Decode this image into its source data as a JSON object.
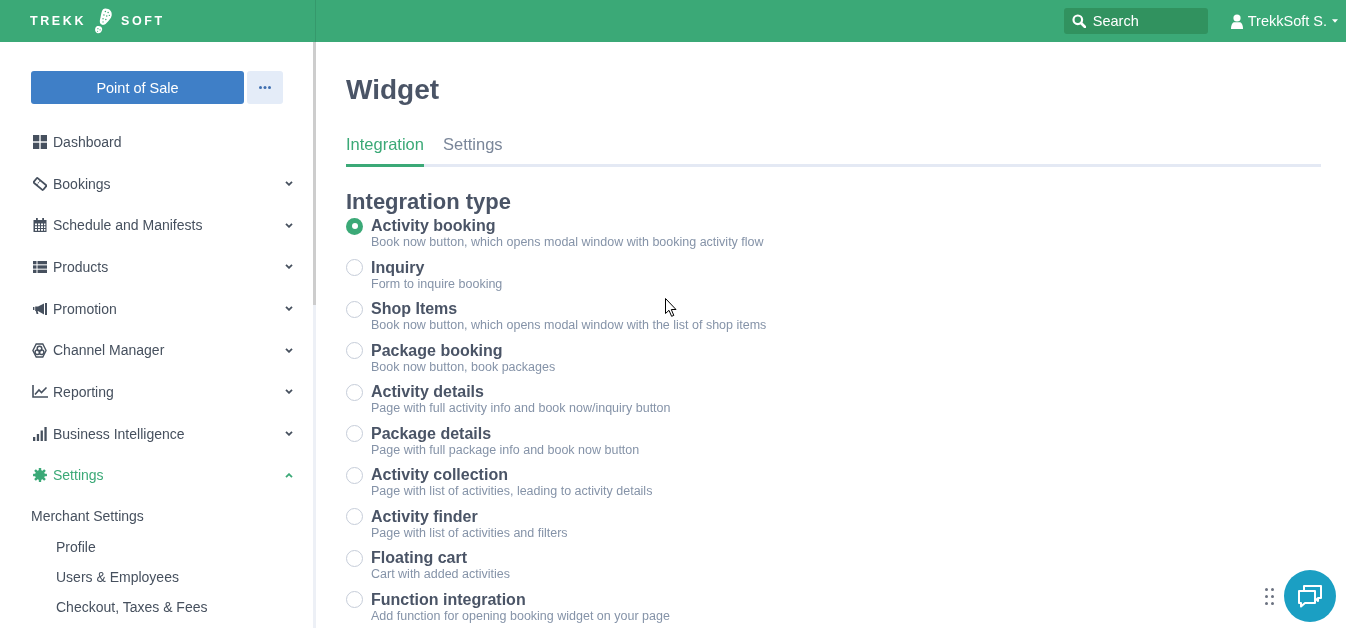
{
  "header": {
    "logo": {
      "left": "TREKK",
      "right": "SOFT"
    },
    "search": {
      "placeholder": "Search"
    },
    "user": {
      "name": "TrekkSoft S."
    }
  },
  "sidebar": {
    "primary_button": {
      "label": "Point of Sale"
    },
    "items": [
      {
        "label": "Dashboard",
        "kind": "link",
        "selected": false
      },
      {
        "label": "Bookings",
        "kind": "group",
        "expanded": false,
        "selected": false
      },
      {
        "label": "Schedule and Manifests",
        "kind": "group",
        "expanded": false,
        "selected": false
      },
      {
        "label": "Products",
        "kind": "group",
        "expanded": false,
        "selected": false
      },
      {
        "label": "Promotion",
        "kind": "group",
        "expanded": false,
        "selected": false
      },
      {
        "label": "Channel Manager",
        "kind": "group",
        "expanded": false,
        "selected": false
      },
      {
        "label": "Reporting",
        "kind": "group",
        "expanded": false,
        "selected": false
      },
      {
        "label": "Business Intelligence",
        "kind": "group",
        "expanded": false,
        "selected": false
      },
      {
        "label": "Settings",
        "kind": "group",
        "expanded": true,
        "selected": true,
        "children": [
          {
            "label": "Merchant Settings",
            "children": [
              {
                "label": "Profile"
              },
              {
                "label": "Users & Employees"
              },
              {
                "label": "Checkout, Taxes & Fees"
              }
            ]
          }
        ]
      }
    ]
  },
  "main": {
    "title": "Widget",
    "tabs": [
      {
        "label": "Integration",
        "selected": true
      },
      {
        "label": "Settings",
        "selected": false
      }
    ],
    "integration": {
      "title": "Integration type",
      "options": [
        {
          "label": "Activity booking",
          "description": "Book now button, which opens modal window with booking activity flow",
          "selected": true
        },
        {
          "label": "Inquiry",
          "description": "Form to inquire booking",
          "selected": false
        },
        {
          "label": "Shop Items",
          "description": "Book now button, which opens modal window with the list of shop items",
          "selected": false
        },
        {
          "label": "Package booking",
          "description": "Book now button, book packages",
          "selected": false
        },
        {
          "label": "Activity details",
          "description": "Page with full activity info and book now/inquiry button",
          "selected": false
        },
        {
          "label": "Package details",
          "description": "Page with full package info and book now button",
          "selected": false
        },
        {
          "label": "Activity collection",
          "description": "Page with list of activities, leading to activity details",
          "selected": false
        },
        {
          "label": "Activity finder",
          "description": "Page with list of activities and filters",
          "selected": false
        },
        {
          "label": "Floating cart",
          "description": "Cart with added activities",
          "selected": false
        },
        {
          "label": "Function integration",
          "description": "Add function for opening booking widget on your page",
          "selected": false
        }
      ]
    }
  }
}
